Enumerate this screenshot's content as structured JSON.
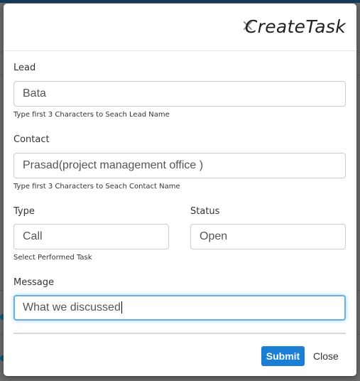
{
  "modal": {
    "close_glyph": "×",
    "title": "CreateTask"
  },
  "form": {
    "lead": {
      "label": "Lead",
      "value": "Bata",
      "hint": "Type first 3 Characters to Seach Lead Name"
    },
    "contact": {
      "label": "Contact",
      "value": "Prasad(project management office )",
      "hint": "Type first 3 Characters to Seach Contact Name"
    },
    "type": {
      "label": "Type",
      "value": "Call",
      "hint": "Select Performed Task"
    },
    "status": {
      "label": "Status",
      "value": "Open"
    },
    "message": {
      "label": "Message",
      "value": "What we discussed"
    }
  },
  "footer": {
    "submit_label": "Submit",
    "close_label": "Close"
  },
  "colors": {
    "accent": "#1a7fd4",
    "focus_border": "#66afe9"
  }
}
